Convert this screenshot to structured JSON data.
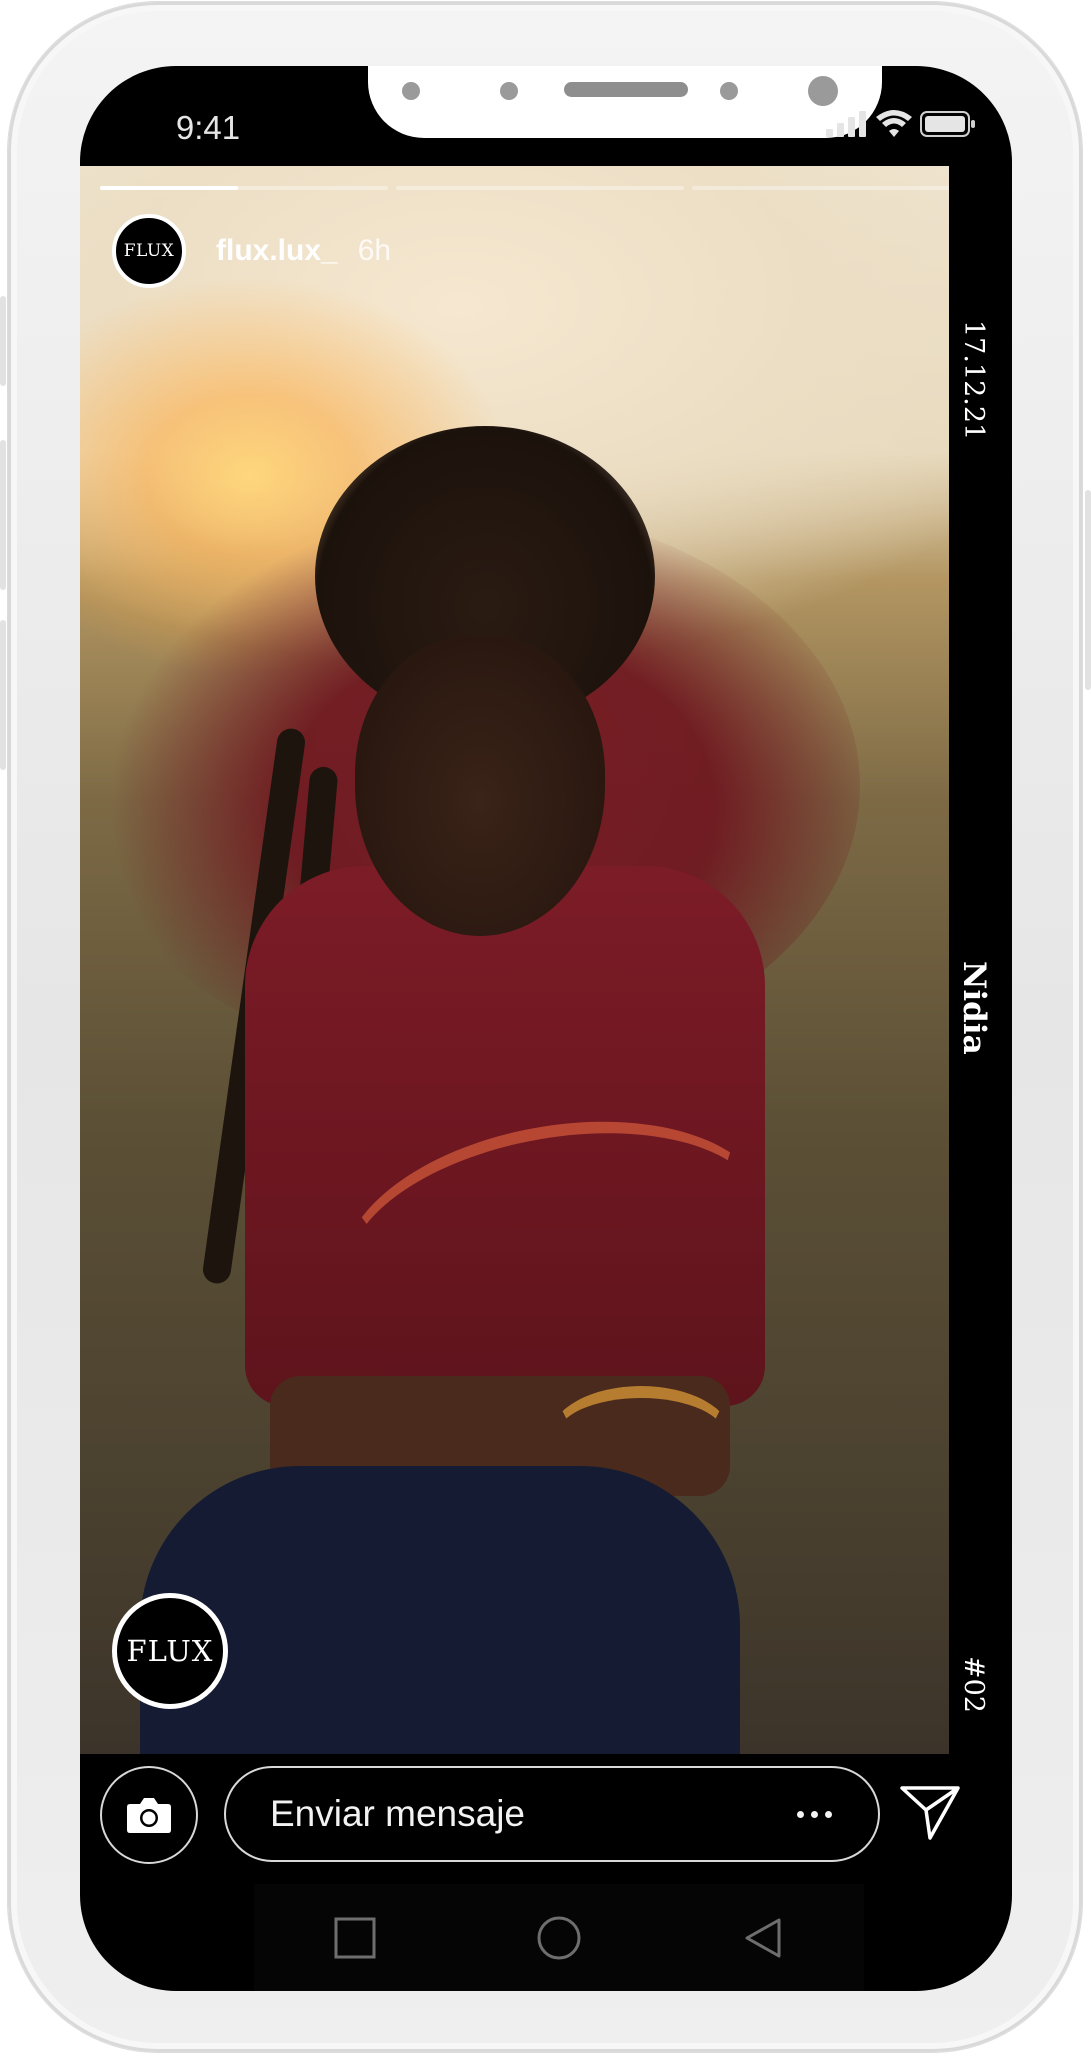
{
  "status_bar": {
    "time": "9:41",
    "signal_icon": "signal-bars-icon",
    "wifi_icon": "wifi-icon",
    "battery_icon": "battery-icon"
  },
  "story": {
    "progress": {
      "segments": 3,
      "active_segment": 1,
      "active_fraction": 0.48
    },
    "header": {
      "avatar_text": "FLUX",
      "username": "flux.lux_",
      "timestamp": "6h"
    },
    "side_strip": {
      "date": "17.12.21",
      "name": "Nidia",
      "number": "#02"
    },
    "brand_badge_text": "FLUX"
  },
  "reply_bar": {
    "camera_icon": "camera-icon",
    "placeholder": "Enviar mensaje",
    "more_icon": "more-dots-icon",
    "send_icon": "paper-plane-icon"
  },
  "nav_bar": {
    "recent_icon": "square-recent-apps-icon",
    "home_icon": "circle-home-icon",
    "back_icon": "triangle-back-icon"
  },
  "colors": {
    "screen_bg": "#000000",
    "frame": "#eeeeee",
    "sweater": "#7c1c27"
  }
}
